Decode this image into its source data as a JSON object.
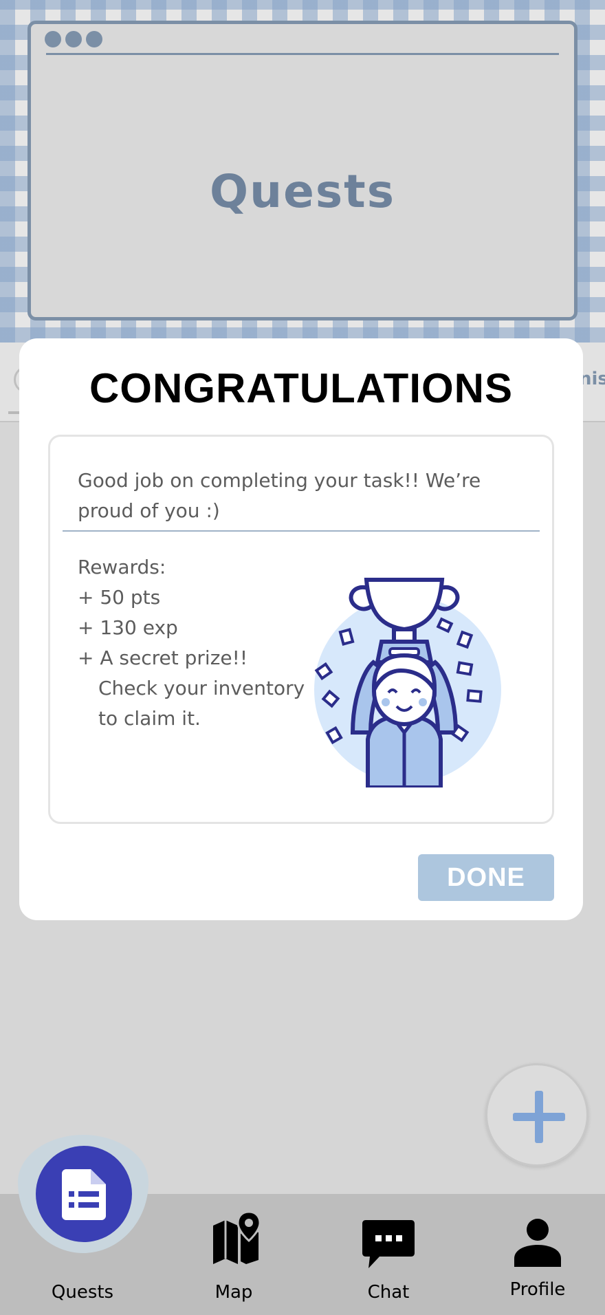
{
  "header": {
    "title": "Quests"
  },
  "background": {
    "partial_tab_text": "nis"
  },
  "modal": {
    "title": "CONGRATULATIONS",
    "message": "Good job on completing your task!! We’re proud of you :)",
    "rewards_heading": "Rewards:",
    "rewards": [
      "+ 50 pts",
      "+ 130 exp",
      "+ A secret prize!!"
    ],
    "reward_note_line1": "Check your inventory",
    "reward_note_line2": "to claim it.",
    "done_label": "DONE",
    "illustration": "trophy-celebration-illustration"
  },
  "fab": {
    "icon": "plus-icon"
  },
  "nav": {
    "items": [
      {
        "label": "Quests",
        "icon": "quests-document-icon",
        "active": true
      },
      {
        "label": "Map",
        "icon": "map-pin-icon",
        "active": false
      },
      {
        "label": "Chat",
        "icon": "chat-bubble-icon",
        "active": false
      },
      {
        "label": "Profile",
        "icon": "person-icon",
        "active": false
      }
    ]
  },
  "colors": {
    "accent": "#3a3fb4",
    "done_button": "#adc6de",
    "header_text": "#6d819a",
    "fab_plus": "#7ea3d6"
  }
}
